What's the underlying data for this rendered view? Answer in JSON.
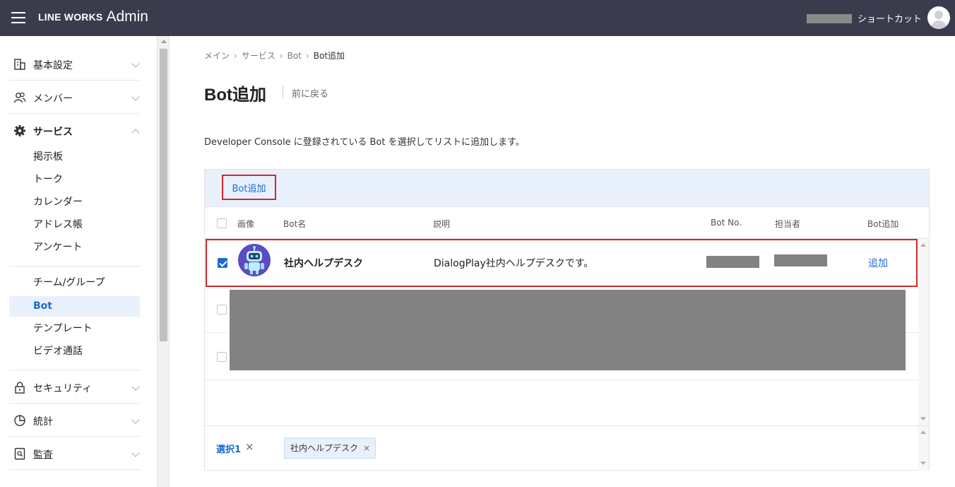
{
  "header": {
    "brand": "LINE WORKS",
    "product": "Admin",
    "shortcut_label": "ショートカット"
  },
  "sidebar": {
    "sections": [
      {
        "label": "基本設定",
        "icon": "building-icon"
      },
      {
        "label": "メンバー",
        "icon": "members-icon"
      },
      {
        "label": "サービス",
        "icon": "gear-icon",
        "open": true
      },
      {
        "label": "セキュリティ",
        "icon": "lock-icon"
      },
      {
        "label": "統計",
        "icon": "pie-chart-icon"
      },
      {
        "label": "監査",
        "icon": "audit-icon"
      }
    ],
    "service_items": [
      "掲示板",
      "トーク",
      "カレンダー",
      "アドレス帳",
      "アンケート",
      "チーム/グループ",
      "Bot",
      "テンプレート",
      "ビデオ通話"
    ],
    "active_item": "Bot"
  },
  "breadcrumb": [
    "メイン",
    "サービス",
    "Bot",
    "Bot追加"
  ],
  "page": {
    "title": "Bot追加",
    "back_label": "前に戻る",
    "description": "Developer Console に登録されている Bot を選択してリストに追加します。"
  },
  "panel": {
    "add_button": "Bot追加",
    "columns": [
      "画像",
      "Bot名",
      "説明",
      "Bot No.",
      "担当者",
      "Bot追加"
    ],
    "rows": [
      {
        "checked": true,
        "name": "社内ヘルプデスク",
        "description": "DialogPlay社内ヘルプデスクです。",
        "action": "追加"
      }
    ],
    "selection": {
      "count_label": "選択1",
      "clear_icon": "×",
      "chip_label": "社内ヘルプデスク",
      "chip_remove": "×"
    }
  },
  "colors": {
    "header_bg": "#3a3c4e",
    "accent": "#1a6bd0",
    "highlight_border": "#d8232a",
    "toolbar_bg": "#e8f1fb",
    "redaction": "#828282"
  }
}
